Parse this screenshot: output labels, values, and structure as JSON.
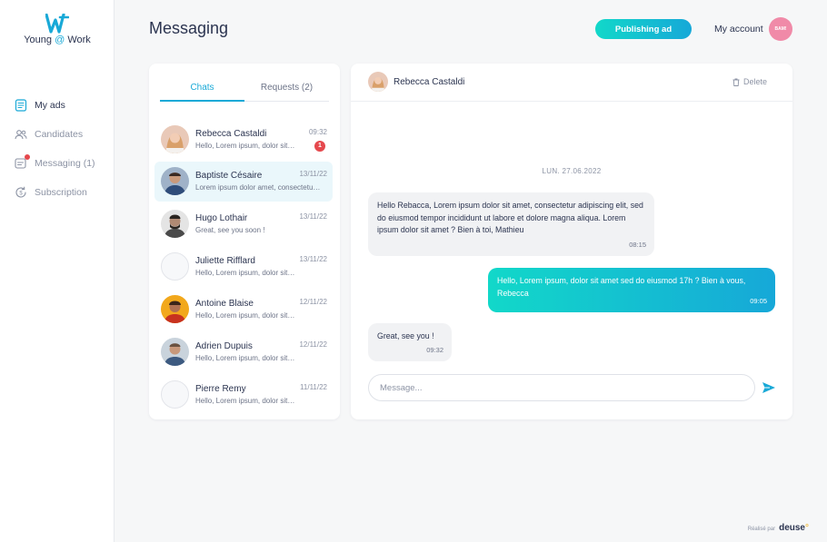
{
  "app": {
    "logo_text_1": "Young",
    "logo_at": "@",
    "logo_text_2": "Work",
    "accent_color": "#19a9d7",
    "gradient": [
      "#12d8c9",
      "#16a8d8"
    ]
  },
  "sidebar": {
    "items": [
      {
        "label": "My ads",
        "icon": "document-icon",
        "active": true
      },
      {
        "label": "Candidates",
        "icon": "users-icon",
        "active": false
      },
      {
        "label": "Messaging (1)",
        "icon": "message-icon",
        "active": false,
        "notification": true
      },
      {
        "label": "Subscription",
        "icon": "subscription-icon",
        "active": false
      }
    ]
  },
  "header": {
    "title": "Messaging",
    "publish_label": "Publishing ad",
    "account_label": "My account",
    "brand_avatar_text": "BAM!"
  },
  "chat_list": {
    "tabs": [
      {
        "label": "Chats",
        "active": true
      },
      {
        "label": "Requests (2)",
        "active": false
      }
    ],
    "conversations": [
      {
        "name": "Rebecca Castaldi",
        "preview": "Hello, Lorem ipsum, dolor sit amet...",
        "time": "09:32",
        "unread": "1",
        "selected": false
      },
      {
        "name": "Baptiste Césaire",
        "preview": "Lorem ipsum dolor amet, consectetur adipiscing",
        "time": "13/11/22",
        "selected": true
      },
      {
        "name": "Hugo Lothair",
        "preview": "Great, see you soon !",
        "time": "13/11/22",
        "selected": false
      },
      {
        "name": "Juliette Rifflard",
        "preview": "Hello, Lorem ipsum, dolor sit amet...",
        "time": "13/11/22",
        "selected": false
      },
      {
        "name": "Antoine Blaise",
        "preview": "Hello, Lorem ipsum, dolor sit amet...",
        "time": "12/11/22",
        "selected": false
      },
      {
        "name": "Adrien Dupuis",
        "preview": "Hello, Lorem ipsum, dolor sit amet...",
        "time": "12/11/22",
        "selected": false
      },
      {
        "name": "Pierre Remy",
        "preview": "Hello, Lorem ipsum, dolor sit amet...",
        "time": "11/11/22",
        "selected": false
      }
    ]
  },
  "conversation": {
    "contact_name": "Rebecca Castaldi",
    "delete_label": "Delete",
    "date_separator": "LUN. 27.06.2022",
    "messages": [
      {
        "direction": "in",
        "text": "Hello Rebacca, Lorem ipsum dolor sit amet, consectetur adipiscing elit, sed do eiusmod tempor incididunt ut labore et dolore magna aliqua. Lorem ipsum dolor sit amet ? Bien à toi, Mathieu",
        "time": "08:15"
      },
      {
        "direction": "out",
        "text": "Hello, Lorem ipsum, dolor sit amet sed do eiusmod 17h ? Bien à vous, Rebecca",
        "time": "09:05"
      },
      {
        "direction": "in",
        "text": "Great, see you !",
        "time": "09:32"
      }
    ],
    "input_placeholder": "Message..."
  },
  "footer": {
    "made_by": "Réalisé par",
    "brand": "deuse",
    "brand_dot": "°"
  }
}
